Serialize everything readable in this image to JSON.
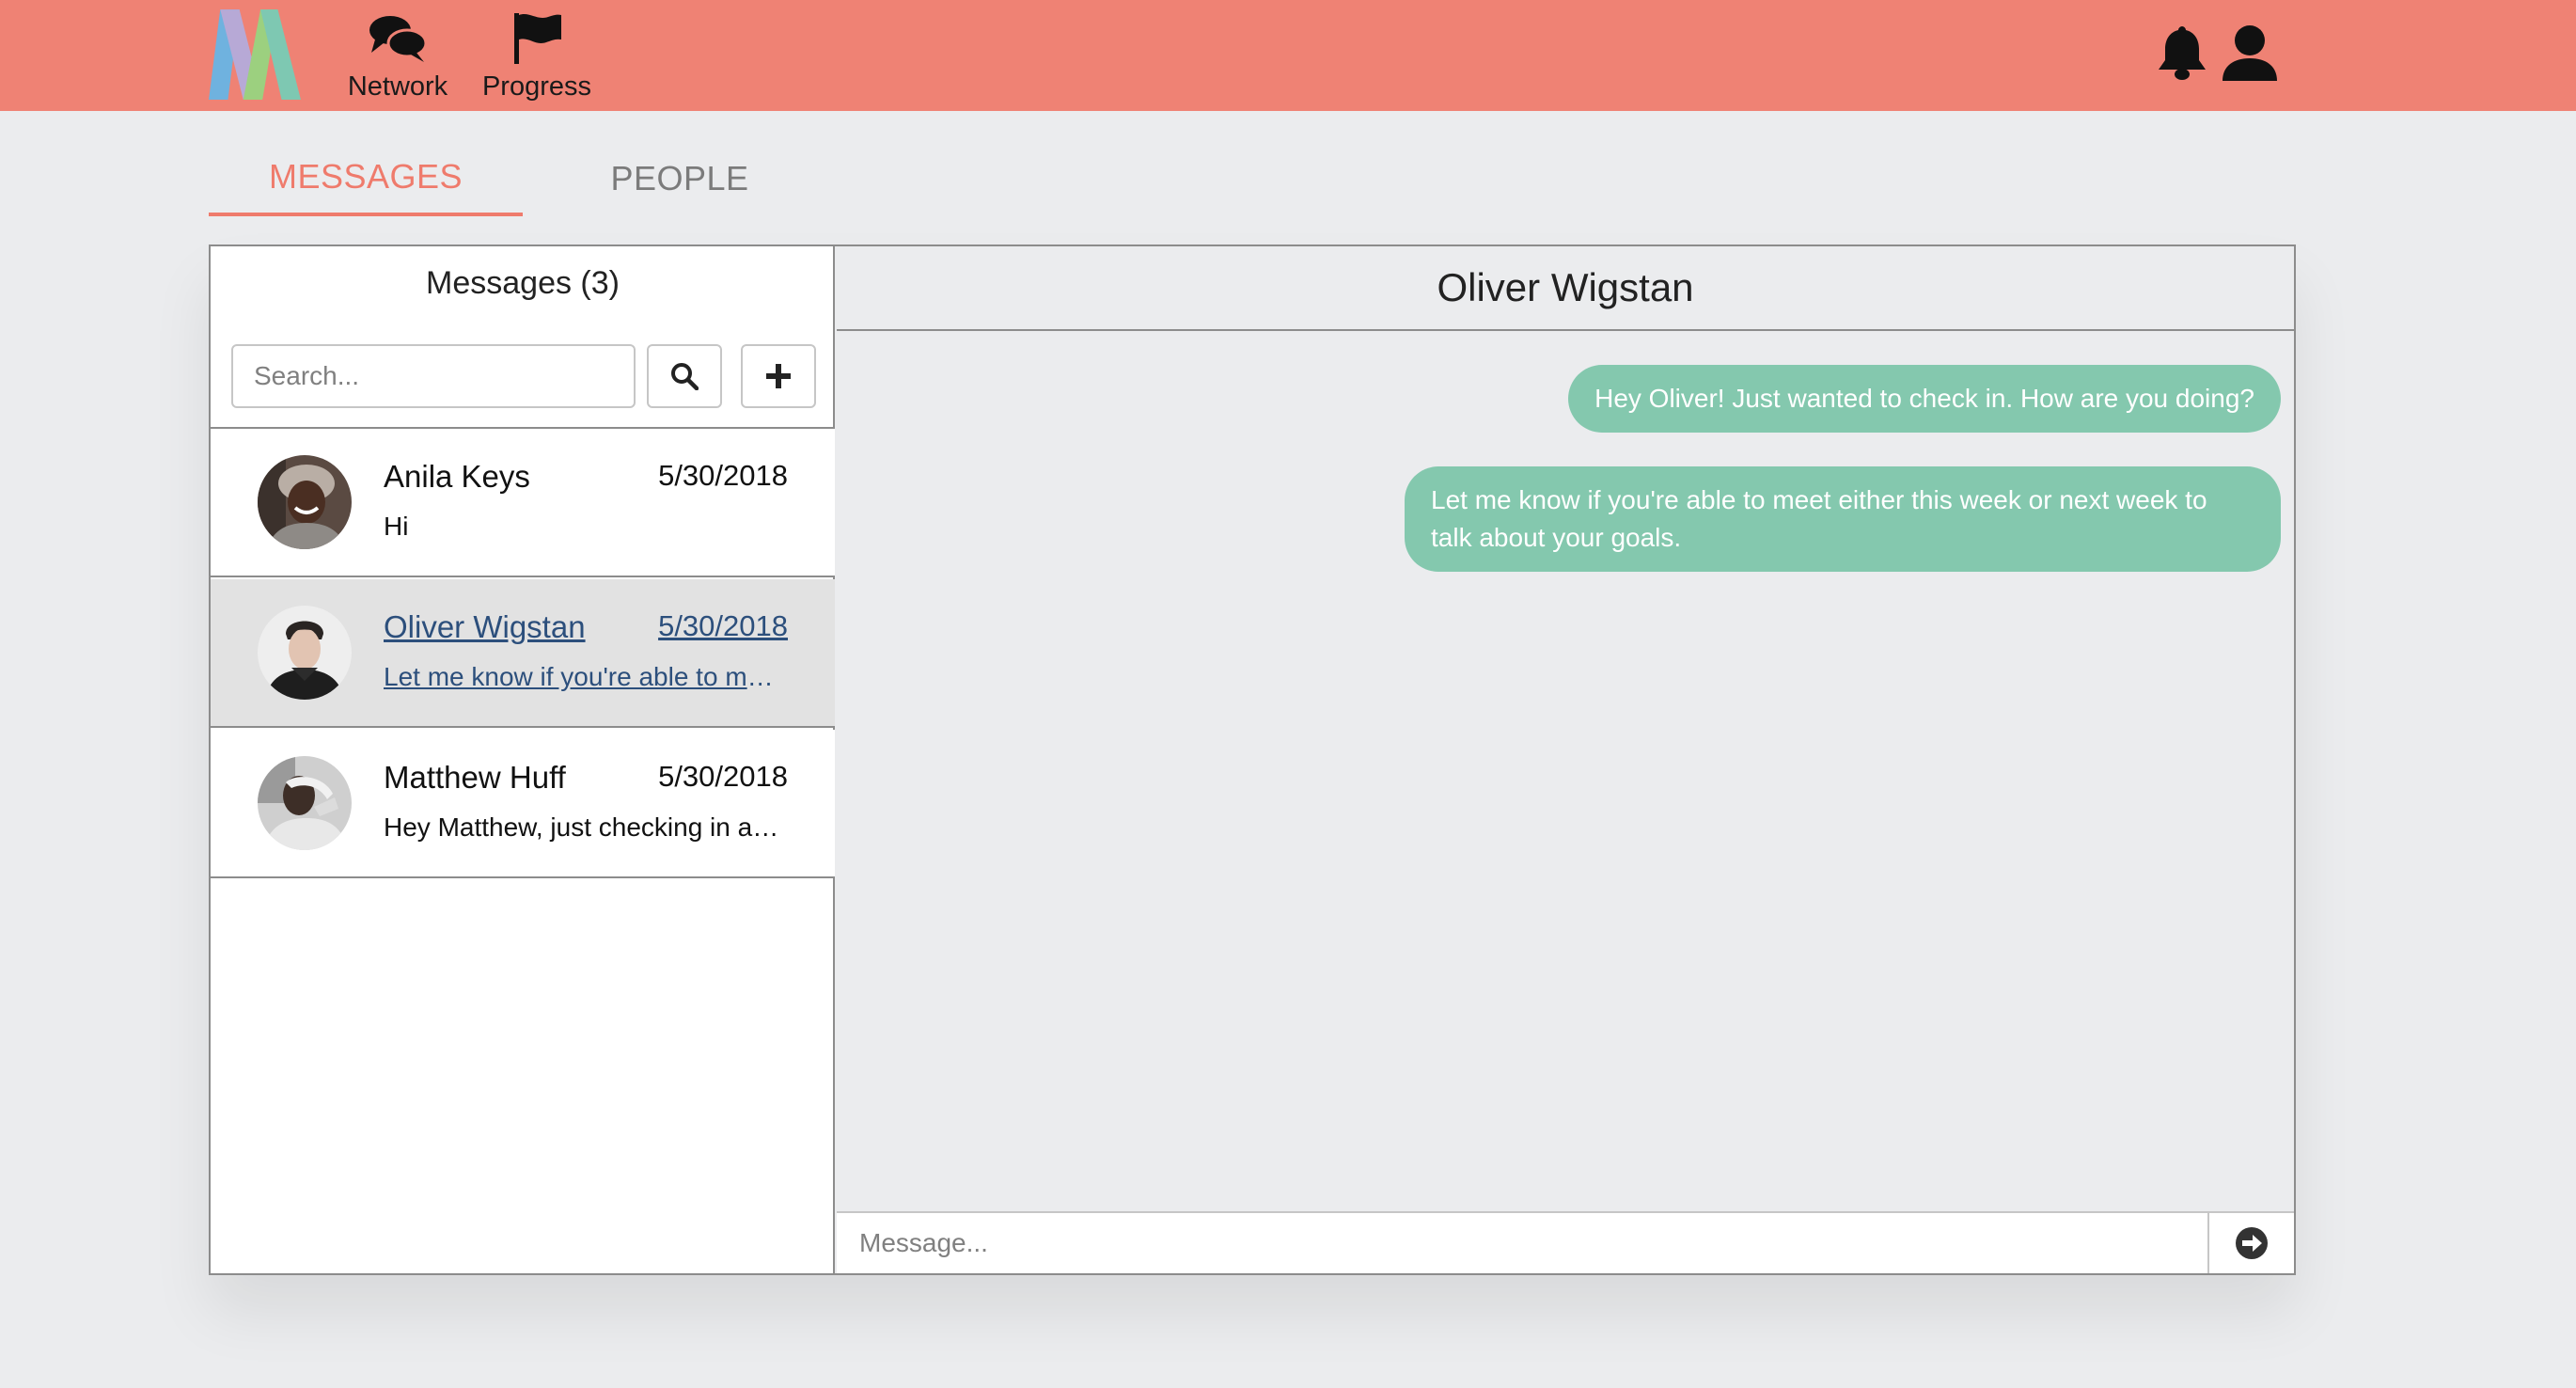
{
  "colors": {
    "topbar": "#ef8274",
    "accent": "#ef7b6c",
    "bubble": "#84c8ae",
    "background": "#ebecee",
    "active_link": "#2c4f7c"
  },
  "nav": {
    "logo_icon": "logo-icon",
    "items": [
      {
        "label": "Network",
        "icon": "chat-bubbles-icon"
      },
      {
        "label": "Progress",
        "icon": "flag-icon"
      }
    ],
    "right_icons": [
      "bell-icon",
      "user-icon"
    ]
  },
  "tabs": [
    {
      "label": "MESSAGES",
      "active": true
    },
    {
      "label": "PEOPLE",
      "active": false
    }
  ],
  "sidebar": {
    "title": "Messages (3)",
    "search_placeholder": "Search...",
    "conversations": [
      {
        "name": "Anila Keys",
        "date": "5/30/2018",
        "snippet": "Hi",
        "active": false
      },
      {
        "name": "Oliver Wigstan",
        "date": "5/30/2018",
        "snippet": "Let me know if you're able to meet either this week or next week to talk about your goals.",
        "active": true
      },
      {
        "name": "Matthew Huff",
        "date": "5/30/2018",
        "snippet": "Hey Matthew, just checking in and seeing how things are going.",
        "active": false
      }
    ]
  },
  "chat": {
    "title": "Oliver Wigstan",
    "messages": [
      "Hey Oliver! Just wanted to check in. How are you doing?",
      "Let me know if you're able to meet either this week or next week to talk about your goals."
    ],
    "input_placeholder": "Message..."
  }
}
